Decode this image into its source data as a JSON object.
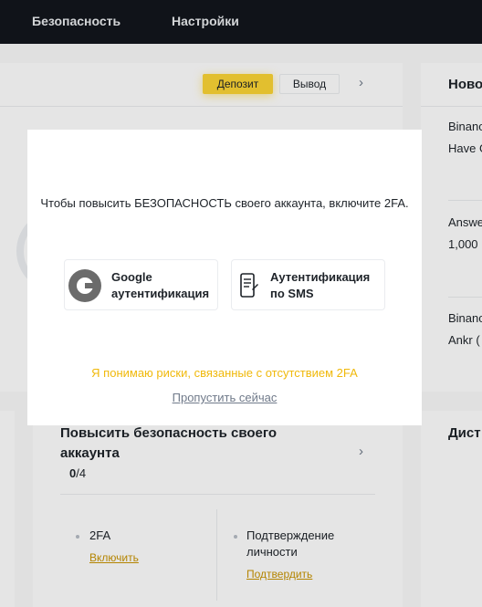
{
  "header": {
    "nav": [
      {
        "label": "Безопасность"
      },
      {
        "label": "Настройки"
      }
    ]
  },
  "balance_card": {
    "deposit_label": "Депозит",
    "withdraw_label": "Вывод"
  },
  "news_card": {
    "title": "Ново",
    "items": [
      {
        "line1": "Binanc",
        "line2": "Have G"
      },
      {
        "line1": "Answe",
        "line2": "1,000"
      },
      {
        "line1": "Binanc",
        "line2": "Ankr ("
      }
    ]
  },
  "security_card": {
    "title": "Повысить безопасность своего аккаунта",
    "progress_done": "0",
    "progress_total": "/4",
    "items": [
      {
        "label": "2FA",
        "action": "Включить"
      },
      {
        "label": "Подтверждение личности",
        "action": "Подтвердить"
      }
    ]
  },
  "distribution_card": {
    "title": "Дист"
  },
  "modal": {
    "message": "Чтобы повысить БЕЗОПАСНОСТЬ своего аккаунта, включите 2FA.",
    "options": [
      {
        "label": "Google\nаутентификация",
        "icon": "google-authenticator-icon"
      },
      {
        "label": "Аутентификация\nпо SMS",
        "icon": "sms-icon"
      }
    ],
    "risk_link": "Я понимаю риски, связанные с отсутствием 2FA",
    "skip_link": "Пропустить сейчас"
  },
  "colors": {
    "accent": "#fcd535",
    "accent_text": "#f0b90b",
    "link": "#c99400",
    "topbar": "#12161c"
  }
}
